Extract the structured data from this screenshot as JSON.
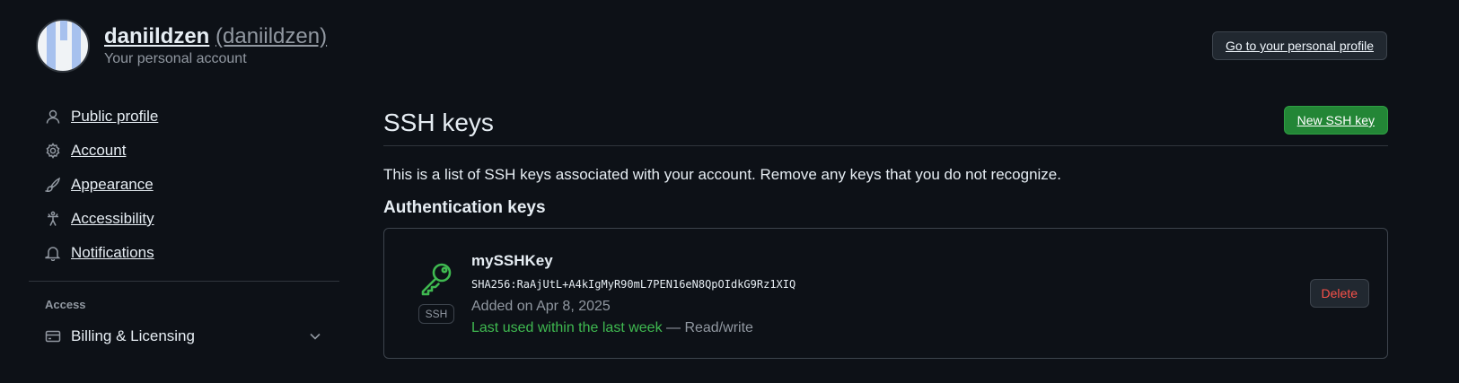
{
  "header": {
    "display_name": "daniildzen",
    "login": "(daniildzen)",
    "subtitle": "Your personal account",
    "profile_button": "Go to your personal profile"
  },
  "sidebar": {
    "items": [
      {
        "label": "Public profile",
        "icon": "person-icon"
      },
      {
        "label": "Account",
        "icon": "gear-icon"
      },
      {
        "label": "Appearance",
        "icon": "paintbrush-icon"
      },
      {
        "label": "Accessibility",
        "icon": "accessibility-icon"
      },
      {
        "label": "Notifications",
        "icon": "bell-icon"
      }
    ],
    "section_access": "Access",
    "access_items": [
      {
        "label": "Billing & Licensing",
        "icon": "credit-card-icon"
      }
    ]
  },
  "main": {
    "title": "SSH keys",
    "new_button": "New SSH key",
    "description": "This is a list of SSH keys associated with your account. Remove any keys that you do not recognize.",
    "auth_heading": "Authentication keys",
    "keys": [
      {
        "title": "mySSHKey",
        "fingerprint": "SHA256:RaAjUtL+A4kIgMyR90mL7PEN16eN8QpOIdkG9Rz1XIQ",
        "added": "Added on Apr 8, 2025",
        "last_used": "Last used within the last week",
        "access": " — Read/write",
        "badge": "SSH",
        "delete_label": "Delete"
      }
    ]
  },
  "colors": {
    "background": "#0d1117",
    "accent_green": "#238636",
    "success_text": "#3fb950",
    "danger_text": "#f85149"
  }
}
